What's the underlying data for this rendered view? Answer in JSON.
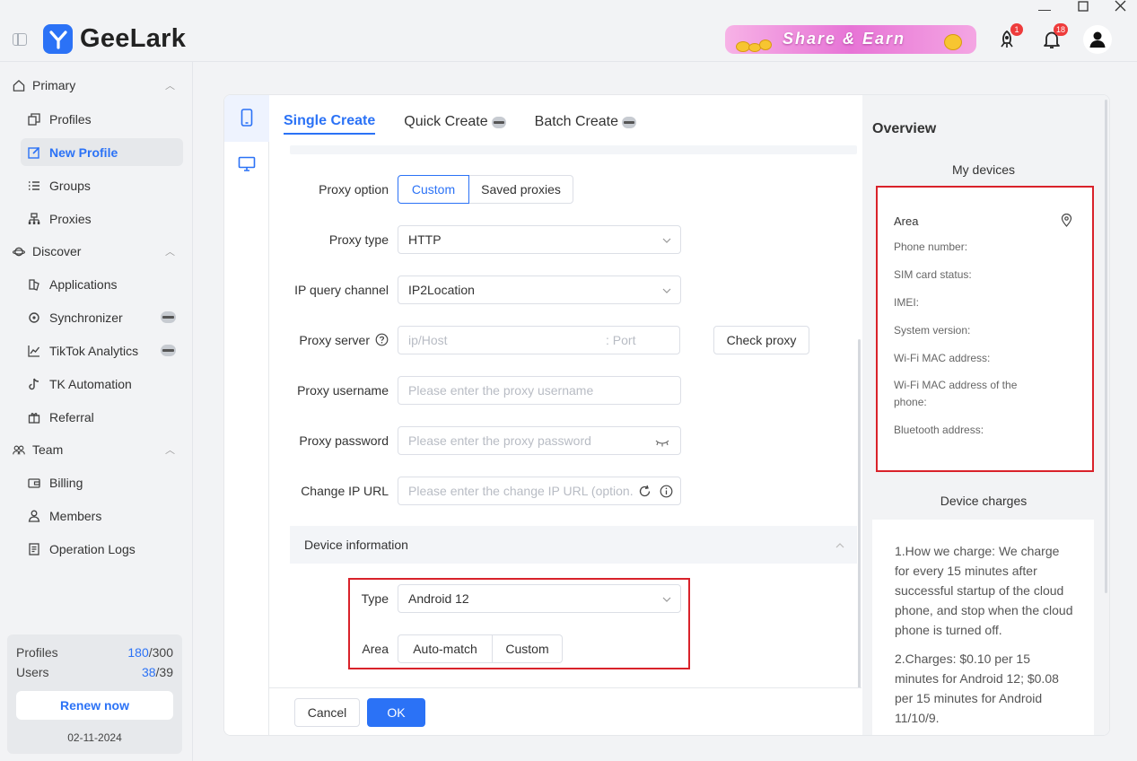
{
  "app": {
    "name": "GeeLark",
    "banner_text": "Share & Earn",
    "rocket_badge": "1",
    "bell_badge": "18"
  },
  "colors": {
    "accent": "#2b72f6",
    "highlight_box": "#d9222a",
    "badge": "#ee3b3b"
  },
  "sidebar": {
    "groups": [
      {
        "label": "Primary",
        "icon": "home-icon",
        "items": [
          {
            "label": "Profiles",
            "icon": "profiles-icon"
          },
          {
            "label": "New Profile",
            "icon": "edit-icon",
            "active": true
          },
          {
            "label": "Groups",
            "icon": "list-icon"
          },
          {
            "label": "Proxies",
            "icon": "proxies-icon"
          }
        ]
      },
      {
        "label": "Discover",
        "icon": "planet-icon",
        "items": [
          {
            "label": "Applications",
            "icon": "applications-icon"
          },
          {
            "label": "Synchronizer",
            "icon": "sync-icon",
            "beta": true
          },
          {
            "label": "TikTok Analytics",
            "icon": "chart-icon",
            "beta": true
          },
          {
            "label": "TK Automation",
            "icon": "tiktok-icon"
          },
          {
            "label": "Referral",
            "icon": "gift-icon"
          }
        ]
      },
      {
        "label": "Team",
        "icon": "team-icon",
        "items": [
          {
            "label": "Billing",
            "icon": "wallet-icon"
          },
          {
            "label": "Members",
            "icon": "members-icon"
          },
          {
            "label": "Operation Logs",
            "icon": "log-icon"
          }
        ]
      }
    ],
    "quota": {
      "profiles_label": "Profiles",
      "profiles_used": "180",
      "profiles_total": "/300",
      "users_label": "Users",
      "users_used": "38",
      "users_total": "/39",
      "renew_label": "Renew now",
      "date": "02-11-2024"
    }
  },
  "tabs": {
    "single": "Single Create",
    "quick": "Quick Create",
    "batch": "Batch Create"
  },
  "form": {
    "proxy_option": {
      "label": "Proxy option",
      "options": [
        "Custom",
        "Saved proxies"
      ],
      "selected": "Custom"
    },
    "proxy_type": {
      "label": "Proxy type",
      "value": "HTTP"
    },
    "ip_query": {
      "label": "IP query channel",
      "value": "IP2Location"
    },
    "proxy_server": {
      "label": "Proxy server",
      "host_placeholder": "ip/Host",
      "port_placeholder": ": Port",
      "check_label": "Check proxy"
    },
    "proxy_username": {
      "label": "Proxy username",
      "placeholder": "Please enter the proxy username"
    },
    "proxy_password": {
      "label": "Proxy password",
      "placeholder": "Please enter the proxy password"
    },
    "change_ip": {
      "label": "Change IP URL",
      "placeholder": "Please enter the change IP URL (option..."
    },
    "device_section": "Device information",
    "device_type": {
      "label": "Type",
      "value": "Android 12"
    },
    "area": {
      "label": "Area",
      "options": [
        "Auto-match",
        "Custom"
      ]
    },
    "cancel_label": "Cancel",
    "ok_label": "OK"
  },
  "overview": {
    "title": "Overview",
    "my_devices": "My devices",
    "device_rows": {
      "area": "Area",
      "phone": "Phone number:",
      "sim": "SIM card status:",
      "imei": "IMEI:",
      "system": "System version:",
      "wifi": "Wi-Fi MAC address:",
      "wifi_phone": "Wi-Fi MAC address of the phone:",
      "bluetooth": "Bluetooth address:"
    },
    "charges_title": "Device charges",
    "charges_p1": "1.How we charge: We charge for every 15 minutes after successful startup of the cloud phone, and stop when the cloud phone is turned off.",
    "charges_p2": "2.Charges: $0.10 per 15 minutes for Android 12; $0.08 per 15 minutes for Android 11/10/9."
  }
}
